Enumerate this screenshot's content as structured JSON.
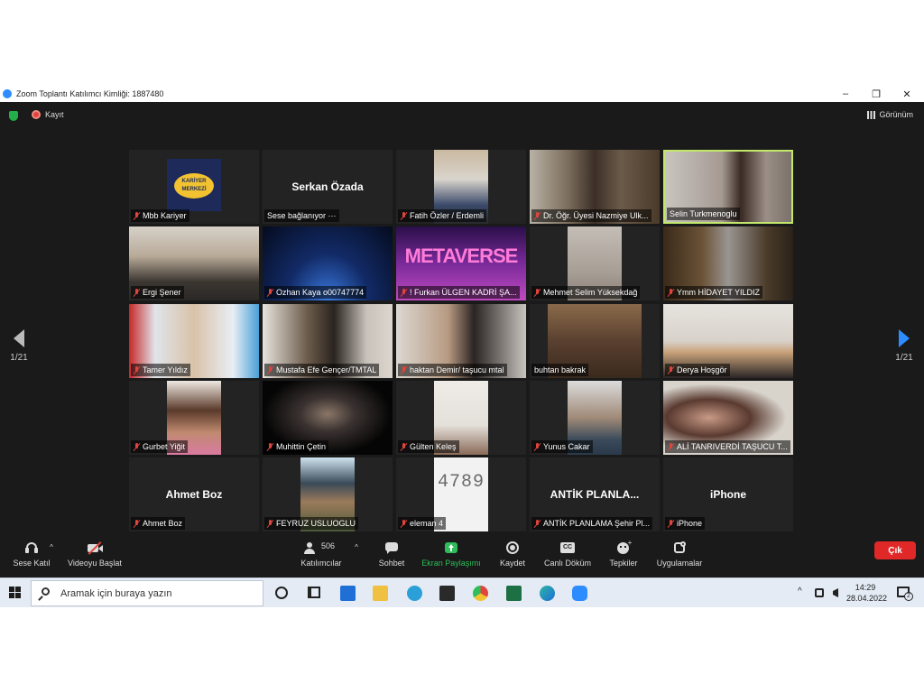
{
  "window": {
    "title": "Zoom Toplantı Katılımcı Kimliği: 1887480",
    "minimize": "–",
    "restore": "❐",
    "close": "✕"
  },
  "top": {
    "record_label": "Kayıt",
    "view_label": "Görünüm"
  },
  "pager": {
    "left": "1/21",
    "right": "1/21"
  },
  "tiles": [
    {
      "name": "Mbb Kariyer",
      "big": ""
    },
    {
      "name": "Sese bağlanıyor ···",
      "big": "Serkan Özada"
    },
    {
      "name": "Fatih Özler / Erdemli",
      "big": ""
    },
    {
      "name": "Dr. Öğr. Üyesi Nazmiye Ulk...",
      "big": ""
    },
    {
      "name": "Selin Turkmenoglu",
      "big": ""
    },
    {
      "name": "Ergi Şener",
      "big": ""
    },
    {
      "name": "Ozhan Kaya o00747774",
      "big": ""
    },
    {
      "name": "! Furkan ÜLGEN KADRİ ŞA...",
      "big": ""
    },
    {
      "name": "Mehmet Selim Yüksekdağ",
      "big": ""
    },
    {
      "name": "Ymm HİDAYET YILDIZ",
      "big": ""
    },
    {
      "name": "Tamer Yıldız",
      "big": ""
    },
    {
      "name": "Mustafa Efe Gençer/TMTAL",
      "big": ""
    },
    {
      "name": "haktan Demir/ taşucu mtal",
      "big": ""
    },
    {
      "name": "buhtan bakrak",
      "big": ""
    },
    {
      "name": "Derya Hoşgör",
      "big": ""
    },
    {
      "name": "Gurbet Yiğit",
      "big": ""
    },
    {
      "name": "Muhittin Çetin",
      "big": ""
    },
    {
      "name": "Gülten Keleş",
      "big": ""
    },
    {
      "name": "Yunus Cakar",
      "big": ""
    },
    {
      "name": "ALİ TANRIVERDİ TAŞUCU T...",
      "big": ""
    },
    {
      "name": "Ahmet Boz",
      "big": "Ahmet Boz"
    },
    {
      "name": "FEYRUZ USLUOGLU",
      "big": ""
    },
    {
      "name": "eleman 4",
      "big": ""
    },
    {
      "name": "ANTİK PLANLAMA Şehir Pl...",
      "big": "ANTİK PLANLA..."
    },
    {
      "name": "iPhone",
      "big": "iPhone"
    }
  ],
  "video_text": {
    "kariyer": "KARİYER MERKEZİ",
    "metaverse": "METAVERSE",
    "captcha": "4789"
  },
  "toolbar": {
    "audio": "Sese Katıl",
    "video": "Videoyu Başlat",
    "participants": "Katılımcılar",
    "participants_count": "506",
    "chat": "Sohbet",
    "share": "Ekran Paylaşımı",
    "record": "Kaydet",
    "captions": "Canlı Döküm",
    "captions_icon": "CC",
    "reactions": "Tepkiler",
    "apps": "Uygulamalar",
    "leave": "Çık"
  },
  "taskbar": {
    "search_placeholder": "Aramak için buraya yazın",
    "time": "14:29",
    "date": "28.04.2022",
    "notif_count": "2"
  },
  "colors": {
    "share_green": "#2ebd59",
    "leave_red": "#e02828",
    "active_border": "#c2e76b",
    "zoom_blue": "#2d8cff"
  }
}
